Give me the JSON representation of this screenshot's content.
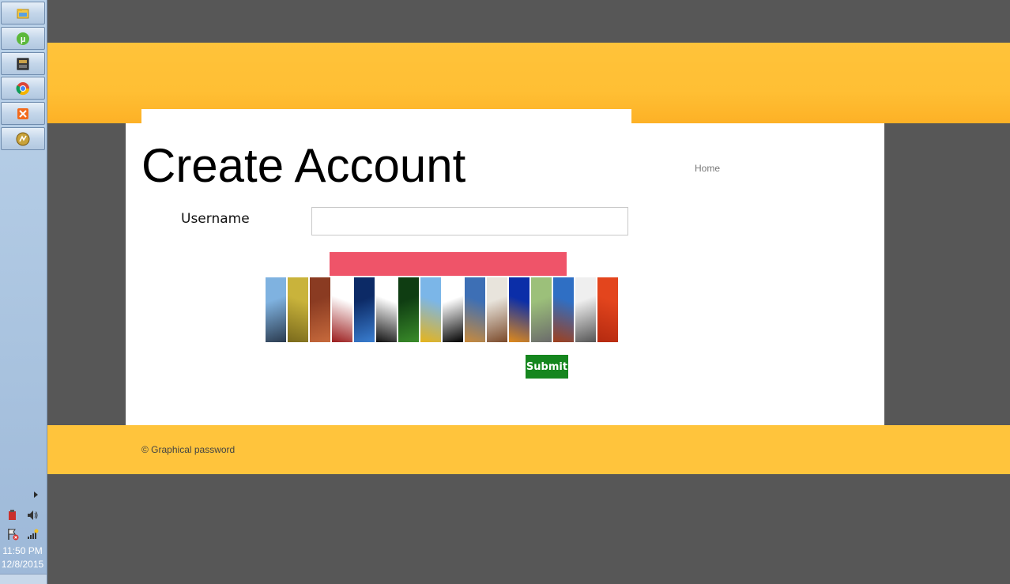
{
  "taskbar": {
    "apps": [
      {
        "name": "windows-explorer",
        "icon": "folder-icon"
      },
      {
        "name": "utorrent",
        "icon": "utorrent-icon"
      },
      {
        "name": "terminal",
        "icon": "console-icon"
      },
      {
        "name": "chrome",
        "icon": "chrome-icon"
      },
      {
        "name": "xampp",
        "icon": "xampp-icon"
      },
      {
        "name": "dreamweaver",
        "icon": "dreamweaver-icon"
      }
    ],
    "clock": {
      "time": "11:50 PM",
      "date": "12/8/2015"
    }
  },
  "header": {
    "nav_home": "Home"
  },
  "form": {
    "title": "Create Account",
    "username_label": "Username",
    "username_value": "",
    "submit_label": "Submit"
  },
  "image_tiles": [
    {
      "name": "penguin",
      "colors": [
        "#7fb2e0",
        "#2b3b4f"
      ]
    },
    {
      "name": "yellow-leaf",
      "colors": [
        "#c9b33b",
        "#7a6a1c"
      ]
    },
    {
      "name": "desert-rocks",
      "colors": [
        "#8a3b22",
        "#c76a3c"
      ]
    },
    {
      "name": "red-logo",
      "colors": [
        "#ffffff",
        "#9b1c1c"
      ]
    },
    {
      "name": "blue-jellyfish",
      "colors": [
        "#0c2a66",
        "#3a7ed0"
      ]
    },
    {
      "name": "chat-bubble",
      "colors": [
        "#ffffff",
        "#111111"
      ]
    },
    {
      "name": "green-leaves",
      "colors": [
        "#0f3d12",
        "#3a8c2a"
      ]
    },
    {
      "name": "yellow-tulips",
      "colors": [
        "#7bb6e8",
        "#e6b41a"
      ]
    },
    {
      "name": "bell-outline",
      "colors": [
        "#ffffff",
        "#000000"
      ]
    },
    {
      "name": "lighthouse",
      "colors": [
        "#3d6fb5",
        "#c98a3b"
      ]
    },
    {
      "name": "paper-shape",
      "colors": [
        "#e8e4dc",
        "#7b4a2a"
      ]
    },
    {
      "name": "blue-orange",
      "colors": [
        "#0b2ea8",
        "#e08a1a"
      ]
    },
    {
      "name": "koala-green",
      "colors": [
        "#9cc07a",
        "#6b6b6b"
      ]
    },
    {
      "name": "canyon",
      "colors": [
        "#2f6fc4",
        "#a0401c"
      ]
    },
    {
      "name": "koala",
      "colors": [
        "#efefef",
        "#555555"
      ]
    },
    {
      "name": "red-flower",
      "colors": [
        "#e3451d",
        "#b42a10"
      ]
    }
  ],
  "footer": {
    "text": "© Graphical password"
  },
  "colors": {
    "page_background": "#575757",
    "header_orange": "#ffbf34",
    "footer_orange": "#ffc43c",
    "alert_red": "#ef5469",
    "submit_green": "#15861e"
  }
}
